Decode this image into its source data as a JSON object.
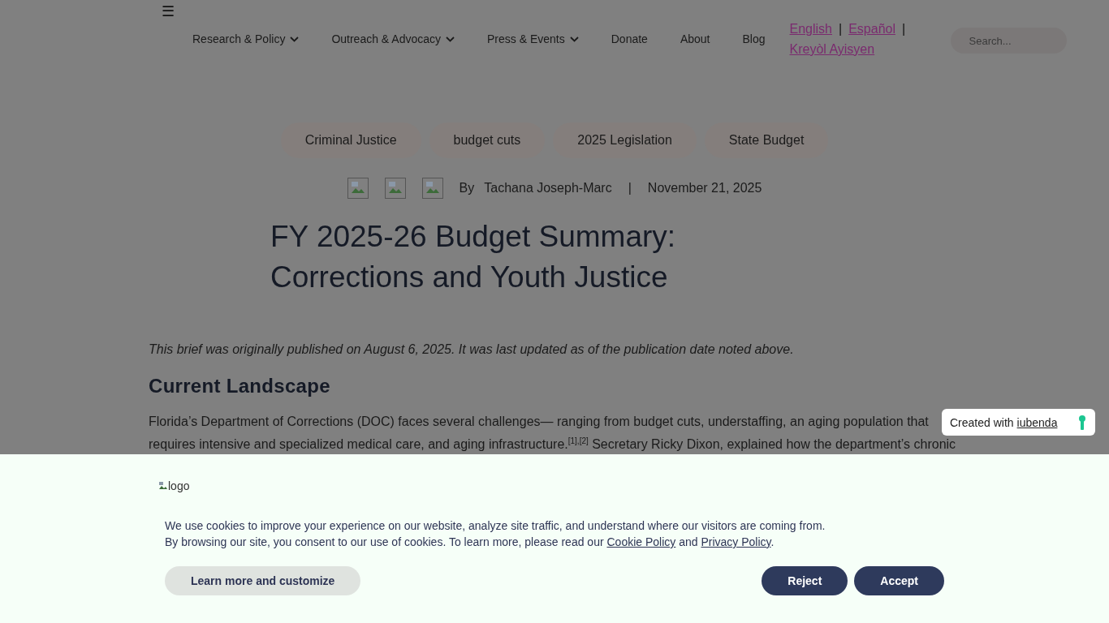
{
  "header": {
    "menu_glyph": "☰",
    "nav": [
      {
        "label": "Research & Policy",
        "has_menu": true
      },
      {
        "label": "Outreach & Advocacy",
        "has_menu": true
      },
      {
        "label": "Press & Events",
        "has_menu": true
      },
      {
        "label": "Donate",
        "has_menu": false
      },
      {
        "label": "About",
        "has_menu": false
      },
      {
        "label": "Blog",
        "has_menu": false
      }
    ],
    "languages": [
      {
        "label": "English",
        "separator": "|"
      },
      {
        "label": "Español",
        "separator": "|"
      },
      {
        "label": "Kreyòl Ayisyen"
      }
    ],
    "search": {
      "placeholder": "Search..."
    }
  },
  "article": {
    "tags": [
      "Criminal Justice",
      "budget cuts",
      "2025 Legislation",
      "State Budget"
    ],
    "share_images": [
      {
        "kind": "broken_image"
      },
      {
        "kind": "broken_image"
      },
      {
        "kind": "broken_image"
      }
    ],
    "byline": {
      "prefix": "By",
      "author": "Tachana Joseph-Marc",
      "separator": "|",
      "date": "November 21, 2025"
    },
    "title": "FY 2025-26 Budget Summary: Corrections and Youth Justice",
    "note": "This brief was originally published on August 6, 2025. It was last updated as of the publication date noted above.",
    "heading": "Current Landscape",
    "paragraph_lines": [
      "Florida’s Department of Corrections (DOC) faces several challenges— ranging from budget cuts, understaffing, an aging population that",
      "requires intensive and specialized medical care, and aging infrastructure.$^{[1],[2]}$ Secretary Ricky Dixon, explained how the department’s chronic"
    ]
  },
  "badge": {
    "text": "Created with",
    "link": "iubenda"
  },
  "cookie_banner": {
    "logo_alt": "logo",
    "line_1": "We use cookies to improve your experience on our website, analyze site traffic, and understand where our visitors are coming from.",
    "line_2": {
      "before": "By browsing our site, you consent to our use of cookies. To learn more, please read our",
      "link_1": "Cookie Policy",
      "between": "and",
      "link_2": "Privacy Policy",
      "after": "."
    },
    "buttons": [
      {
        "label": "Learn more and customize",
        "kind": "secondary"
      },
      {
        "label": "Reject",
        "kind": "primary"
      },
      {
        "label": "Accept",
        "kind": "primary"
      }
    ]
  }
}
